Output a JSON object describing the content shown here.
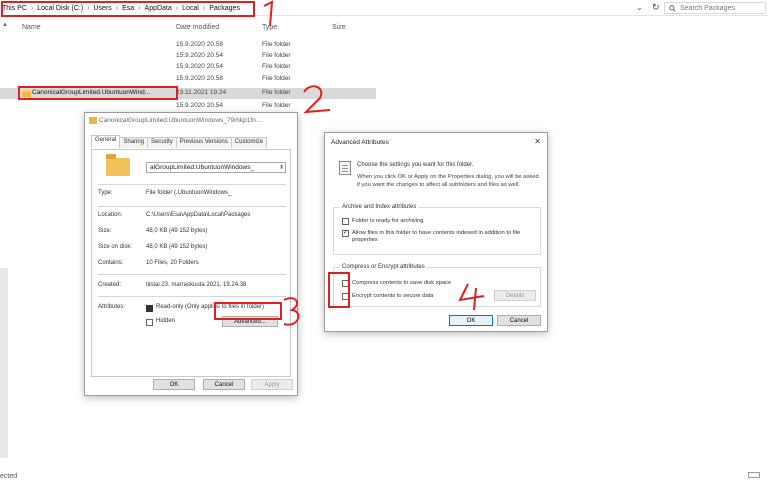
{
  "explorer": {
    "breadcrumb": [
      "This PC",
      "Local Disk (C:)",
      "Users",
      "Esa",
      "AppData",
      "Local",
      "Packages"
    ],
    "search_placeholder": "Search Packages",
    "columns": [
      "Name",
      "Date modified",
      "Type",
      "Size"
    ],
    "rows": [
      {
        "name": "",
        "date": "15.9.2020 20.58",
        "type": "File folder"
      },
      {
        "name": "",
        "date": "15.9.2020 20.54",
        "type": "File folder"
      },
      {
        "name": "",
        "date": "15.9.2020 20.54",
        "type": "File folder"
      },
      {
        "name": "",
        "date": "15.9.2020 20.58",
        "type": "File folder"
      },
      {
        "name": "CanonicalGroupLimited.UbuntuonWind...",
        "date": "23.11.2021 19.24",
        "type": "File folder"
      },
      {
        "name": "",
        "date": "15.9.2020 20.54",
        "type": "File folder"
      }
    ],
    "status": "ected"
  },
  "properties": {
    "title": "CanonicalGroupLimited.UbuntuonWindows_79rhkp1fn...",
    "tabs": [
      "General",
      "Sharing",
      "Security",
      "Previous Versions",
      "Customize"
    ],
    "folder_name": "alGroupLimited.UbuntuonWindows_",
    "fields": [
      {
        "label": "Type:",
        "value": "File folder (.UbuntuonWindows_"
      },
      {
        "label": "Location:",
        "value": "C:\\Users\\Esa\\AppData\\Local\\Packages"
      },
      {
        "label": "Size:",
        "value": "48,0 KB (49 152 bytes)"
      },
      {
        "label": "Size on disk:",
        "value": "48,0 KB (49 152 bytes)"
      },
      {
        "label": "Contains:",
        "value": "10 Files, 20 Folders"
      },
      {
        "label": "Created:",
        "value": "tiistai 23. marraskuuta 2021, 19.24.38"
      }
    ],
    "attributes_label": "Attributes:",
    "readonly_label": "Read-only (Only applies to files in folder)",
    "hidden_label": "Hidden",
    "advanced_button": "Advanced...",
    "ok": "OK",
    "cancel": "Cancel",
    "apply": "Apply"
  },
  "advanced": {
    "title": "Advanced Attributes",
    "intro": "Choose the settings you want for this folder.",
    "intro2": "When you click OK or Apply on the Properties dialog, you will be asked if you want the changes to affect all subfolders and files as well.",
    "archive_group": "Archive and Index attributes",
    "archiving": "Folder is ready for archiving",
    "indexing": "Allow files in this folder to have contents indexed in addition to file properties",
    "compress_group": "Compress or Encrypt attributes",
    "compress": "Compress contents to save disk space",
    "encrypt": "Encrypt contents to secure data",
    "details": "Details",
    "ok": "OK",
    "cancel": "Cancel"
  },
  "annotations": {
    "colors": {
      "red": "#e02020",
      "accent": "#0078d7",
      "folder": "#f0c35a"
    }
  }
}
